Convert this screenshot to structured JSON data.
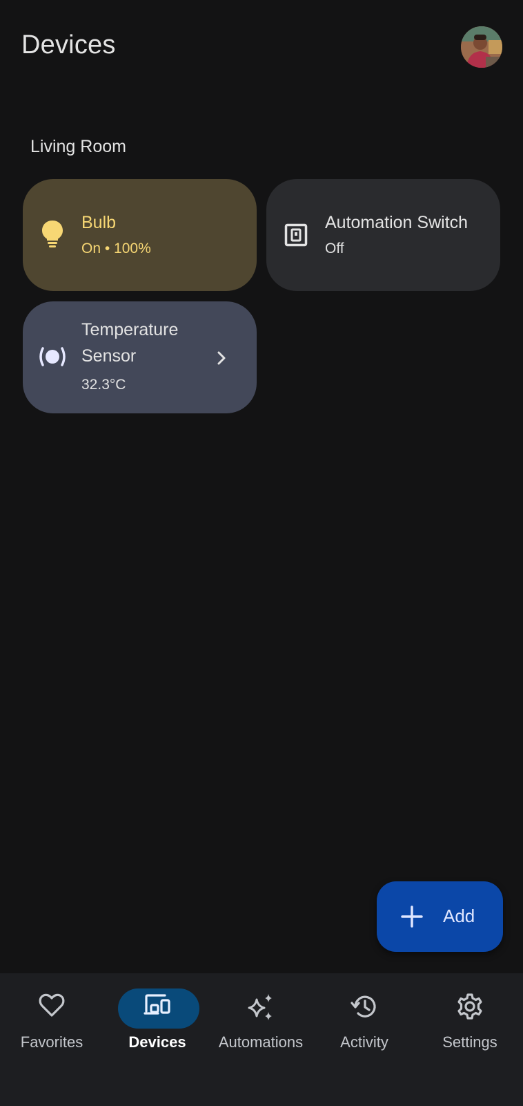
{
  "header": {
    "title": "Devices",
    "avatar_icon": "user-avatar"
  },
  "section": {
    "title": "Living Room"
  },
  "devices": [
    {
      "name": "Bulb",
      "status": "On • 100%",
      "icon": "lightbulb-icon",
      "state": "on"
    },
    {
      "name": "Automation Switch",
      "status": "Off",
      "icon": "switch-icon",
      "state": "off"
    },
    {
      "name": "Temperature Sensor",
      "status": "32.3°C",
      "icon": "sensor-icon",
      "state": "reading"
    }
  ],
  "fab": {
    "label": "Add",
    "icon": "plus-icon"
  },
  "nav": {
    "items": [
      {
        "label": "Favorites",
        "icon": "heart-icon",
        "active": false
      },
      {
        "label": "Devices",
        "icon": "devices-icon",
        "active": true
      },
      {
        "label": "Automations",
        "icon": "sparkle-icon",
        "active": false
      },
      {
        "label": "Activity",
        "icon": "history-icon",
        "active": false
      },
      {
        "label": "Settings",
        "icon": "gear-icon",
        "active": false
      }
    ]
  },
  "colors": {
    "background": "#131314",
    "bulb_tile": "#4f4630",
    "bulb_text": "#f7d774",
    "switch_tile": "#2a2b2e",
    "sensor_tile": "#434859",
    "fab": "#0b47a8",
    "nav_active": "#094a7a"
  }
}
